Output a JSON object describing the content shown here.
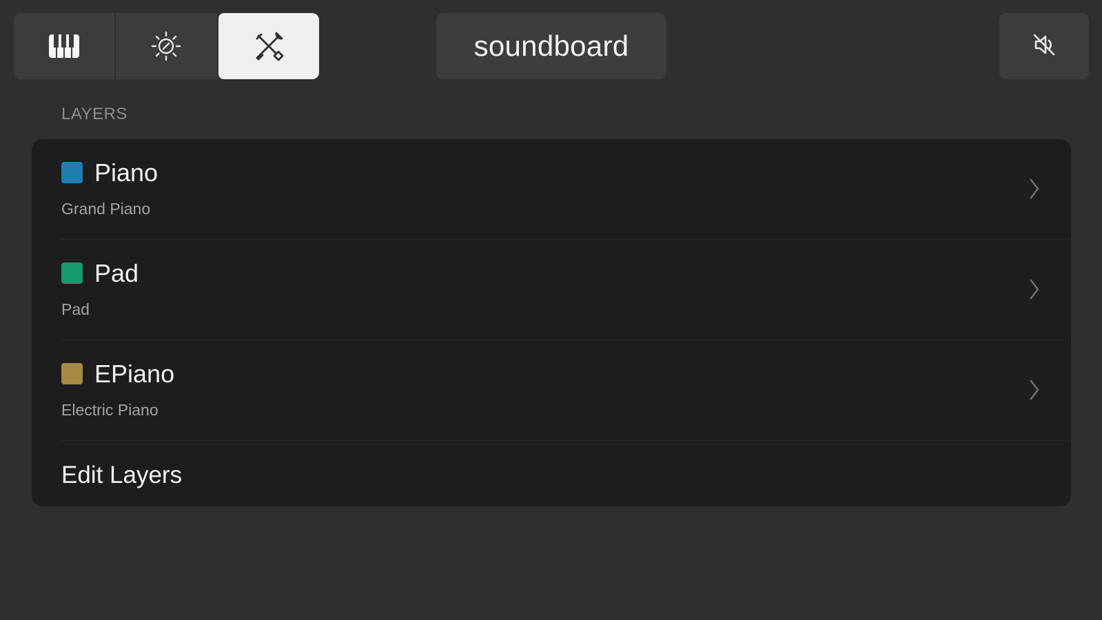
{
  "toolbar": {
    "tabs": [
      {
        "icon": "piano-keys-icon",
        "active": false
      },
      {
        "icon": "sun-settings-icon",
        "active": false
      },
      {
        "icon": "tools-icon",
        "active": true
      }
    ],
    "title": "soundboard",
    "mute_icon": "speaker-muted-icon"
  },
  "layers": {
    "header": "LAYERS",
    "items": [
      {
        "name": "Piano",
        "subtitle": "Grand Piano",
        "color": "#1d7fb0"
      },
      {
        "name": "Pad",
        "subtitle": "Pad",
        "color": "#179a6b"
      },
      {
        "name": "EPiano",
        "subtitle": "Electric Piano",
        "color": "#a88a44"
      }
    ],
    "edit_label": "Edit Layers"
  }
}
